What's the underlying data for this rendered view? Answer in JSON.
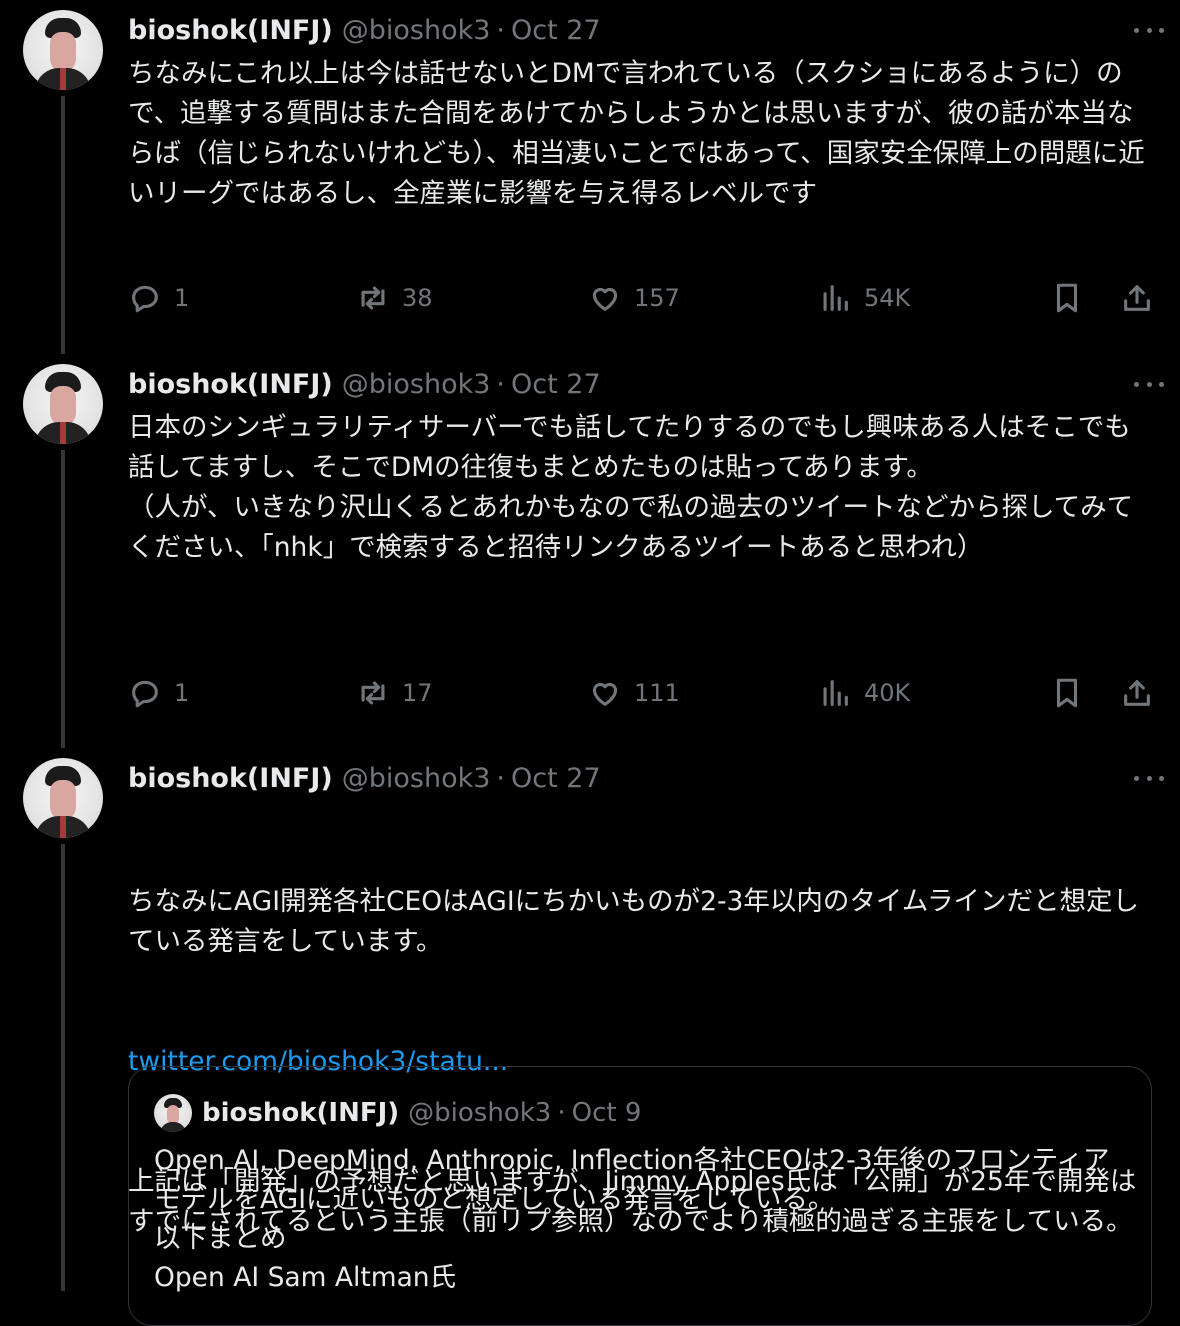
{
  "tweets": [
    {
      "author": {
        "name": "bioshok(INFJ)",
        "handle": "@bioshok3"
      },
      "separator": "·",
      "date": "Oct 27",
      "text": "ちなみにこれ以上は今は話せないとDMで言われている（スクショにあるように）ので、追撃する質問はまた合間をあけてからしようかとは思いますが、彼の話が本当ならば（信じられないけれども）、相当凄いことではあって、国家安全保障上の問題に近いリーグではあるし、全産業に影響を与え得るレベルです",
      "stats": {
        "replies": "1",
        "reposts": "38",
        "likes": "157",
        "views": "54K"
      }
    },
    {
      "author": {
        "name": "bioshok(INFJ)",
        "handle": "@bioshok3"
      },
      "separator": "·",
      "date": "Oct 27",
      "text": "日本のシンギュラリティサーバーでも話してたりするのでもし興味ある人はそこでも話してますし、そこでDMの往復もまとめたものは貼ってあります。\n（人が、いきなり沢山くるとあれかもなので私の過去のツイートなどから探してみてください、「nhk」で検索すると招待リンクあるツイートあると思われ）",
      "stats": {
        "replies": "1",
        "reposts": "17",
        "likes": "111",
        "views": "40K"
      }
    },
    {
      "author": {
        "name": "bioshok(INFJ)",
        "handle": "@bioshok3"
      },
      "separator": "·",
      "date": "Oct 27",
      "text": "ちなみにAGI開発各社CEOはAGIにちかいものが2-3年以内のタイムラインだと想定している発言をしています。",
      "link": "twitter.com/bioshok3/statu...",
      "text_after": "上記は「開発」の予想だと思いますが、Jimmy Apples氏は「公開」が25年で開発はすでにされてるという主張（前リプ参照）なのでより積極的過ぎる主張をしている。",
      "quote": {
        "author": {
          "name": "bioshok(INFJ)",
          "handle": "@bioshok3"
        },
        "separator": "·",
        "date": "Oct 9",
        "text": "Open AI, DeepMind, Anthropic, Inflection各社CEOは2-3年後のフロンティアモデルをAGIに近いものと想定している発言をしている。\n以下まとめ\nOpen AI Sam Altman氏"
      }
    }
  ],
  "icons": [
    "reply-icon",
    "repost-icon",
    "like-icon",
    "views-icon",
    "bookmark-icon",
    "share-icon",
    "more-icon"
  ],
  "colors": {
    "background": "#000000",
    "text": "#e7e9ea",
    "muted": "#71767b",
    "link": "#1d9bf0",
    "border": "#2f3336"
  }
}
